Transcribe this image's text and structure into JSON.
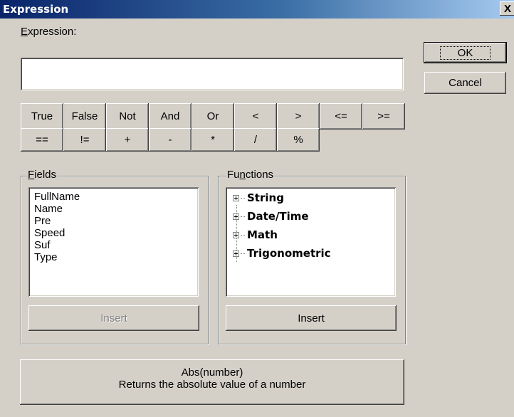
{
  "window": {
    "title": "Expression",
    "close": "X"
  },
  "expression": {
    "label_prefix": "",
    "label_accel": "E",
    "label_rest": "xpression:",
    "value": ""
  },
  "dialog_buttons": {
    "ok": "OK",
    "cancel": "Cancel"
  },
  "operators": {
    "row1": [
      "True",
      "False",
      "Not",
      "And",
      "Or",
      "<",
      ">",
      "<=",
      ">="
    ],
    "row2": [
      "==",
      "!=",
      "+",
      "-",
      "*",
      "/",
      "%"
    ]
  },
  "fields": {
    "legend_accel": "F",
    "legend_rest": "ields",
    "items": [
      "FullName",
      "Name",
      "Pre",
      "Speed",
      "Suf",
      "Type"
    ],
    "insert_label": "Insert"
  },
  "functions": {
    "legend_pre": "Fu",
    "legend_accel": "n",
    "legend_rest": "ctions",
    "nodes": [
      "String",
      "Date/Time",
      "Math",
      "Trigonometric"
    ],
    "insert_label": "Insert"
  },
  "description": {
    "signature": "Abs(number)",
    "text": "Returns the absolute value of a number"
  }
}
